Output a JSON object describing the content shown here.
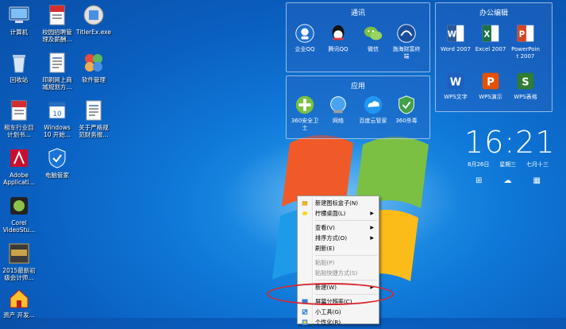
{
  "desktop_icons": [
    {
      "label": "计算机",
      "icon": "computer-icon"
    },
    {
      "label": "校园招聘管\n理及薪酬...",
      "icon": "pdf-icon"
    },
    {
      "label": "TitlerEx.exe",
      "icon": "titlerex-icon"
    },
    {
      "label": "回收站",
      "icon": "recycle-bin-icon"
    },
    {
      "label": "印刷网上商\n城规划方...",
      "icon": "document-icon"
    },
    {
      "label": "软件管理",
      "icon": "software-manager-icon"
    },
    {
      "label": "租车行业目\n计划书...",
      "icon": "pdf-doc-icon"
    },
    {
      "label": "Windows\n10 开始...",
      "icon": "calendar-icon"
    },
    {
      "label": "关于严格规\n范财务报...",
      "icon": "word-doc-icon"
    },
    {
      "label": "Adobe\nApplicati...",
      "icon": "adobe-icon"
    },
    {
      "label": "电脑管家",
      "icon": "shield-icon"
    },
    {
      "label": "Corel\nVideoStu...",
      "icon": "corel-icon"
    },
    {
      "label": "2015最新初\n级会计师...",
      "icon": "exam-icon"
    },
    {
      "label": "资产 开发...",
      "icon": "house-icon"
    }
  ],
  "groups": {
    "comm": {
      "title": "通讯",
      "tiles": [
        {
          "label": "企业QQ",
          "icon": "enterprise-qq-icon"
        },
        {
          "label": "腾讯QQ",
          "icon": "qq-icon"
        },
        {
          "label": "微信",
          "icon": "wechat-icon"
        },
        {
          "label": "渤海财富终\n端",
          "icon": "bohai-icon"
        }
      ]
    },
    "office": {
      "title": "办公编辑",
      "tiles": [
        {
          "label": "Word 2007",
          "icon": "word-icon"
        },
        {
          "label": "Excel 2007",
          "icon": "excel-icon"
        },
        {
          "label": "PowerPoin\nt 2007",
          "icon": "powerpoint-icon"
        },
        {
          "label": "WPS文字",
          "icon": "wps-writer-icon"
        },
        {
          "label": "WPS演示",
          "icon": "wps-presentation-icon"
        },
        {
          "label": "WPS表格",
          "icon": "wps-spreadsheet-icon"
        }
      ]
    },
    "apps": {
      "title": "应用",
      "tiles": [
        {
          "label": "360安全卫\n士",
          "icon": "360-safe-icon"
        },
        {
          "label": "网络",
          "icon": "network-icon"
        },
        {
          "label": "百度云管家",
          "icon": "baidu-cloud-icon"
        },
        {
          "label": "360杀毒",
          "icon": "360-antivirus-icon"
        }
      ]
    }
  },
  "clock": {
    "time": "16:21",
    "date": "8月26日",
    "weekday": "星期三",
    "lunar": "七月十三"
  },
  "context_menu": {
    "items": [
      {
        "label": "新建图标盒子(N)",
        "disabled": false,
        "submenu": false,
        "icon": "box-icon"
      },
      {
        "label": "柠檬桌面(L)",
        "disabled": false,
        "submenu": true,
        "icon": "lemon-icon"
      },
      {
        "sep": true
      },
      {
        "label": "查看(V)",
        "disabled": false,
        "submenu": true
      },
      {
        "label": "排序方式(O)",
        "disabled": false,
        "submenu": true
      },
      {
        "label": "刷新(E)",
        "disabled": false,
        "submenu": false
      },
      {
        "sep": true
      },
      {
        "label": "粘贴(P)",
        "disabled": true,
        "submenu": false
      },
      {
        "label": "粘贴快捷方式(S)",
        "disabled": true,
        "submenu": false
      },
      {
        "sep": true
      },
      {
        "label": "新建(W)",
        "disabled": false,
        "submenu": true
      },
      {
        "sep": true
      },
      {
        "label": "屏幕分辨率(C)",
        "disabled": false,
        "submenu": false,
        "icon": "display-icon"
      },
      {
        "label": "小工具(G)",
        "disabled": false,
        "submenu": false,
        "icon": "gadget-icon"
      },
      {
        "label": "个性化(R)",
        "disabled": false,
        "submenu": false,
        "icon": "personalize-icon"
      }
    ]
  },
  "colors": {
    "annotation": "#d9262e",
    "desktop": "#0f78d8"
  }
}
